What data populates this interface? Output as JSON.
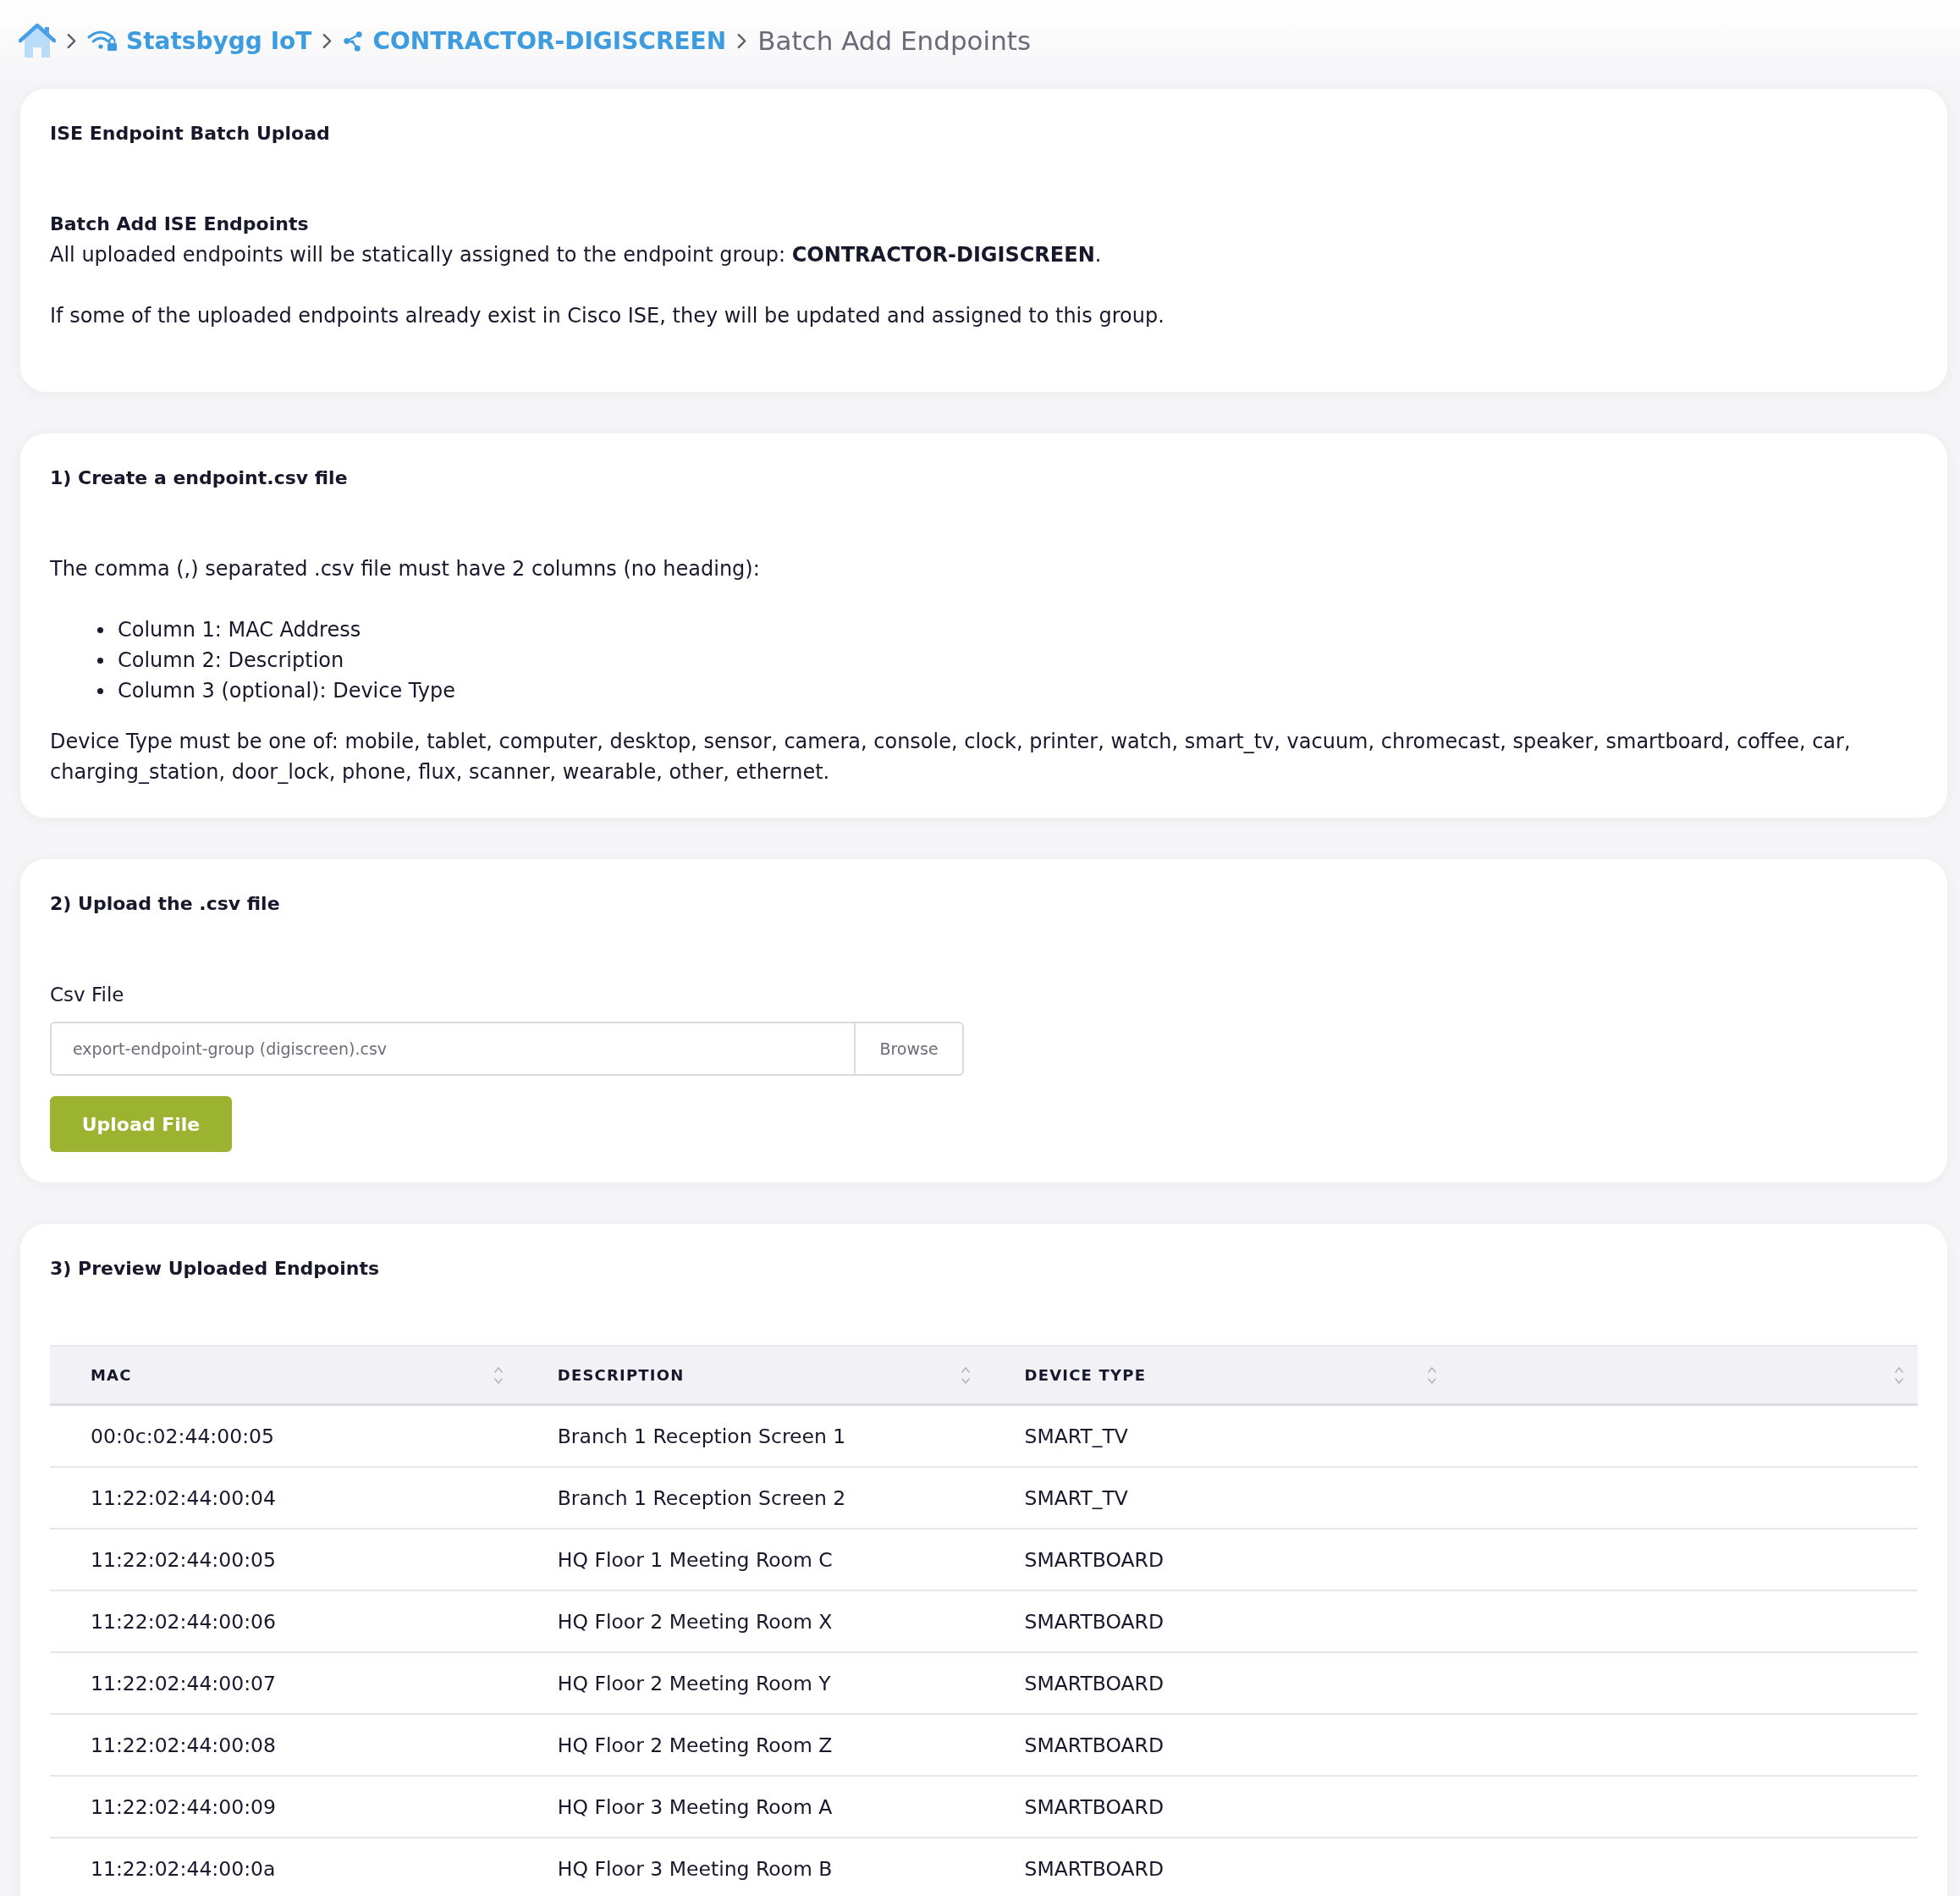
{
  "breadcrumb": [
    {
      "kind": "home"
    },
    {
      "kind": "site",
      "label": "Statsbygg IoT"
    },
    {
      "kind": "group",
      "label": "CONTRACTOR-DIGISCREEN"
    },
    {
      "kind": "current",
      "label": "Batch Add Endpoints"
    }
  ],
  "intro": {
    "title": "ISE Endpoint Batch Upload",
    "subtitle": "Batch Add ISE Endpoints",
    "paragraphs": [
      "All uploaded endpoints will be statically assigned to the endpoint group: **CONTRACTOR-DIGISCREEN**.",
      "If some of the uploaded endpoints already exist in Cisco ISE, they will be updated and assigned to this group."
    ]
  },
  "create_step": {
    "title": "1) Create a endpoint.csv file",
    "intro": "The comma (,) separated .csv file must have 2 columns (no heading):",
    "list": [
      "Column 1: MAC Address",
      "Column 2: Description",
      "Column 3 (optional): Device Type"
    ],
    "note": "Device Type must be one of: mobile, tablet, computer, desktop, sensor, camera, console, clock, printer, watch, smart_tv, vacuum, chromecast, speaker, smartboard, coffee, car, charging_station, door_lock, phone, flux, scanner, wearable, other, ethernet."
  },
  "upload_step": {
    "title": "2) Upload the .csv file",
    "field": {
      "label": "Csv File",
      "value": "export-endpoint-group (digiscreen).csv",
      "button": "Browse"
    },
    "submit": "Upload File"
  },
  "preview_step": {
    "title": "3) Preview Uploaded Endpoints",
    "table": {
      "columns": [
        {
          "label": "MAC",
          "sortable": true
        },
        {
          "label": "DESCRIPTION",
          "sortable": true
        },
        {
          "label": "DEVICE TYPE",
          "sortable": true
        },
        {
          "sortable": true
        }
      ],
      "rows": [
        [
          "00:0c:02:44:00:05",
          "Branch 1 Reception Screen 1",
          "SMART_TV"
        ],
        [
          "11:22:02:44:00:04",
          "Branch 1 Reception Screen 2",
          "SMART_TV"
        ],
        [
          "11:22:02:44:00:05",
          "HQ Floor 1 Meeting Room C",
          "SMARTBOARD"
        ],
        [
          "11:22:02:44:00:06",
          "HQ Floor 2 Meeting Room X",
          "SMARTBOARD"
        ],
        [
          "11:22:02:44:00:07",
          "HQ Floor 2 Meeting Room Y",
          "SMARTBOARD"
        ],
        [
          "11:22:02:44:00:08",
          "HQ Floor 2 Meeting Room Z",
          "SMARTBOARD"
        ],
        [
          "11:22:02:44:00:09",
          "HQ Floor 3 Meeting Room A",
          "SMARTBOARD"
        ],
        [
          "11:22:02:44:00:0a",
          "HQ Floor 3 Meeting Room B",
          "SMARTBOARD"
        ]
      ]
    }
  }
}
